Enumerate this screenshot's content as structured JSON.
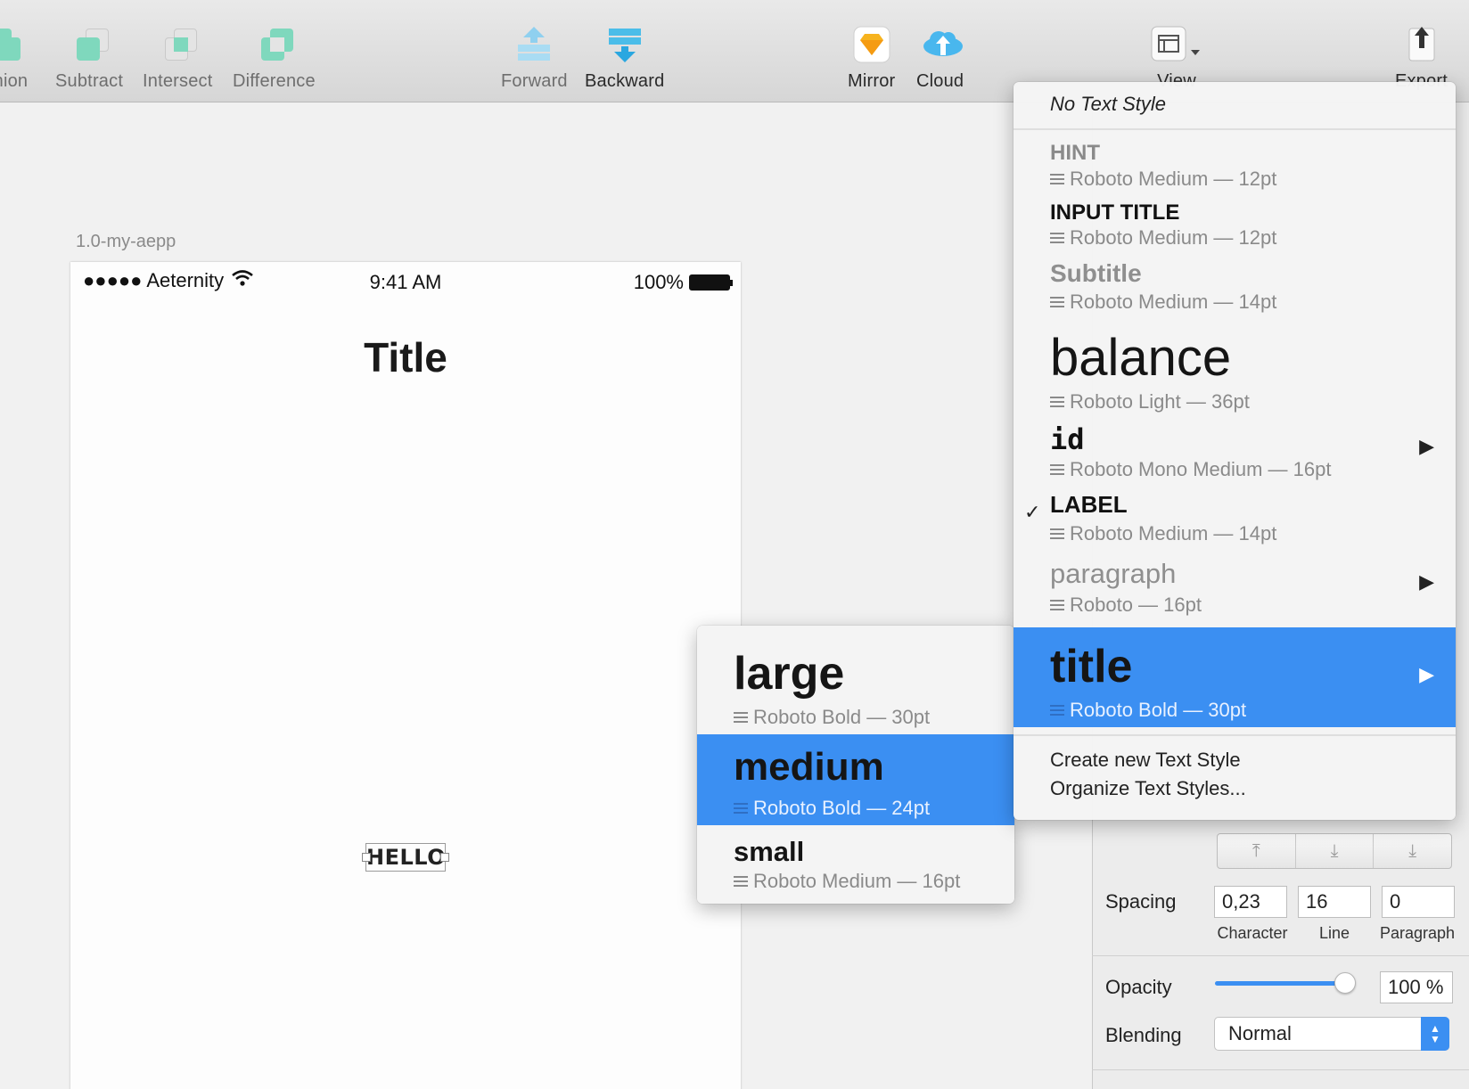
{
  "toolbar": {
    "union": "Union",
    "subtract": "Subtract",
    "intersect": "Intersect",
    "difference": "Difference",
    "forward": "Forward",
    "backward": "Backward",
    "mirror": "Mirror",
    "cloud": "Cloud",
    "view": "View",
    "export": "Export"
  },
  "canvas": {
    "artboard_name": "1.0-my-aepp",
    "status_bar": {
      "carrier": "●●●●● Aeternity",
      "time": "9:41 AM",
      "battery": "100%"
    },
    "title": "Title",
    "hello": "HELLO"
  },
  "text_style_menu": {
    "no_style": "No Text Style",
    "items": [
      {
        "name": "HINT",
        "meta": "Roboto Medium — 12pt"
      },
      {
        "name": "INPUT TITLE",
        "meta": "Roboto Medium — 12pt"
      },
      {
        "name": "Subtitle",
        "meta": "Roboto Medium — 14pt"
      },
      {
        "name": "balance",
        "meta": "Roboto Light — 36pt"
      },
      {
        "name": "id",
        "meta": "Roboto Mono Medium — 16pt"
      },
      {
        "name": "LABEL",
        "meta": "Roboto Medium — 14pt"
      },
      {
        "name": "paragraph",
        "meta": "Roboto — 16pt"
      },
      {
        "name": "title",
        "meta": "Roboto Bold — 30pt"
      }
    ],
    "checked": "✓",
    "submenu_arrow": "▶",
    "create": "Create new Text Style",
    "organize": "Organize Text Styles..."
  },
  "title_submenu": {
    "items": [
      {
        "name": "large",
        "meta": "Roboto Bold — 30pt"
      },
      {
        "name": "medium",
        "meta": "Roboto Bold — 24pt"
      },
      {
        "name": "small",
        "meta": "Roboto Medium — 16pt"
      }
    ]
  },
  "inspector": {
    "spacing_label": "Spacing",
    "character_value": "0,23",
    "line_value": "16",
    "paragraph_value": "0",
    "character_label": "Character",
    "line_label": "Line",
    "paragraph_label": "Paragraph",
    "opacity_label": "Opacity",
    "opacity_value": "100 %",
    "opacity_level": 1.0,
    "blending_label": "Blending",
    "blending_value": "Normal"
  },
  "colors": {
    "accent": "#3b8ff2",
    "bool_ops": "#6fd2b4"
  }
}
